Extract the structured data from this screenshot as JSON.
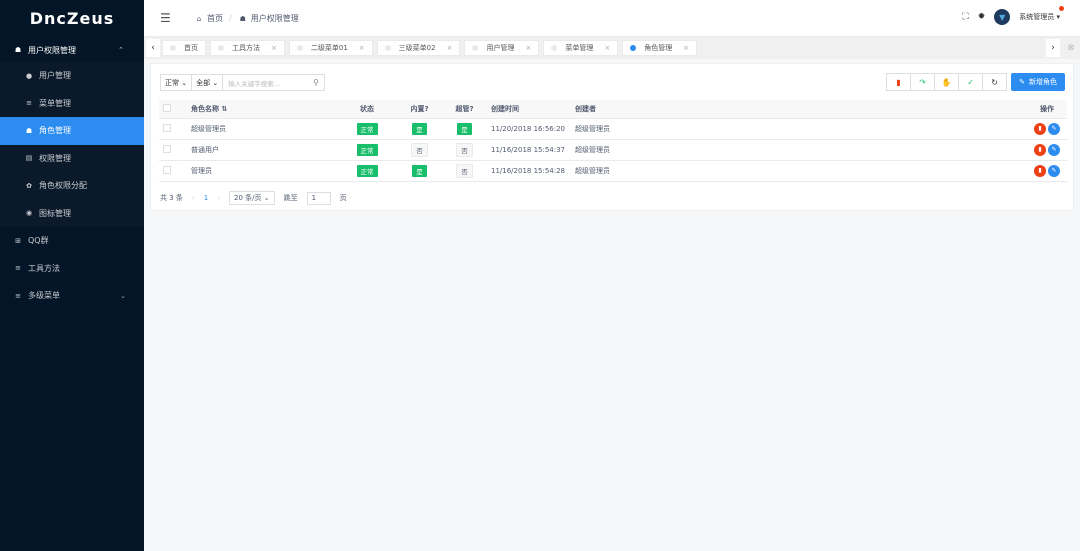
{
  "app": {
    "logo": "DncZeus"
  },
  "sidebar": {
    "group": {
      "label": "用户权限管理",
      "chev": "⌃"
    },
    "subitems": [
      {
        "label": "用户管理",
        "icon": "●"
      },
      {
        "label": "菜单管理",
        "icon": "≡"
      },
      {
        "label": "角色管理",
        "icon": "☗"
      },
      {
        "label": "权限管理",
        "icon": "▤"
      },
      {
        "label": "角色权限分配",
        "icon": "✿"
      },
      {
        "label": "图标管理",
        "icon": "◉"
      }
    ],
    "items": [
      {
        "label": "QQ群",
        "icon": "⊞"
      },
      {
        "label": "工具方法",
        "icon": "≡"
      },
      {
        "label": "多级菜单",
        "icon": "≡",
        "chev": "⌄"
      }
    ]
  },
  "header": {
    "breadcrumb": [
      {
        "label": "首页",
        "icon": "⌂"
      },
      {
        "label": "用户权限管理",
        "icon": "☗"
      }
    ],
    "separator": "/",
    "user_name": "系统管理员"
  },
  "tabs": [
    {
      "label": "首页"
    },
    {
      "label": "工具方法",
      "close": "×"
    },
    {
      "label": "二级菜单01",
      "close": "×"
    },
    {
      "label": "三级菜单02",
      "close": "×"
    },
    {
      "label": "用户管理",
      "close": "×"
    },
    {
      "label": "菜单管理",
      "close": "×"
    },
    {
      "label": "角色管理",
      "close": "×"
    }
  ],
  "filters": {
    "status": "正常 ⌄",
    "scope": "全部 ⌄",
    "search_placeholder": "输入关键字搜索..."
  },
  "toolbar": {
    "add_label": "新增角色"
  },
  "table": {
    "headers": {
      "name": "角色名称 ⇅",
      "status": "状态",
      "builtin": "内置?",
      "super": "超管?",
      "created": "创建时间",
      "creator": "创建者",
      "ops": "操作"
    },
    "rows": [
      {
        "name": "超级管理员",
        "status": "正常",
        "builtin": "是",
        "super": "是",
        "created": "11/20/2018 16:56:20",
        "creator": "超级管理员"
      },
      {
        "name": "普通用户",
        "status": "正常",
        "builtin": "否",
        "super": "否",
        "created": "11/16/2018 15:54:37",
        "creator": "超级管理员"
      },
      {
        "name": "管理员",
        "status": "正常",
        "builtin": "是",
        "super": "否",
        "created": "11/16/2018 15:54:28",
        "creator": "超级管理员"
      }
    ]
  },
  "pager": {
    "total": "共 3 条",
    "prev": "‹",
    "current": "1",
    "next": "›",
    "page_size": "20 条/页 ⌄",
    "jump_label": "跳至",
    "jump_value": "1",
    "page_label": "页"
  },
  "colors": {
    "accent": "#2d8cf0",
    "success": "#19be6b",
    "danger": "#ed4014",
    "sidebar": "#041527"
  }
}
